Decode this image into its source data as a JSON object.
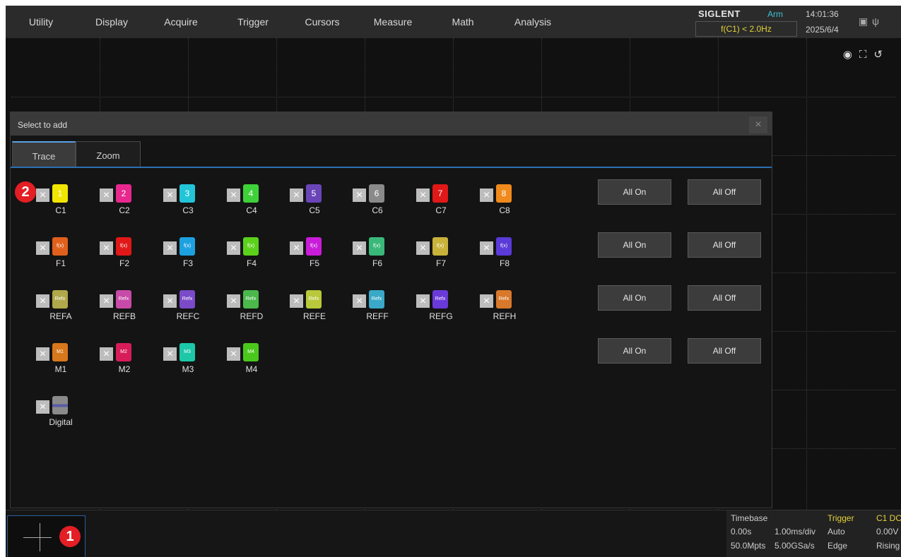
{
  "menu": [
    "Utility",
    "Display",
    "Acquire",
    "Trigger",
    "Cursors",
    "Measure",
    "Math",
    "Analysis"
  ],
  "status": {
    "brand": "SIGLENT",
    "state": "Arm",
    "trigger_condition": "f(C1) < 2.0Hz",
    "time": "14:01:36",
    "date": "2025/6/4"
  },
  "toolbar_icons": [
    "camera-icon",
    "fullscreen-icon",
    "rotate-icon"
  ],
  "dialog": {
    "title": "Select to add",
    "close": "×",
    "tabs": [
      "Trace",
      "Zoom"
    ],
    "active_tab": "Trace",
    "rows": [
      {
        "items": [
          {
            "label": "C1",
            "badge": "1",
            "color": "#f2e600"
          },
          {
            "label": "C2",
            "badge": "2",
            "color": "#e8278f"
          },
          {
            "label": "C3",
            "badge": "3",
            "color": "#22c4d8"
          },
          {
            "label": "C4",
            "badge": "4",
            "color": "#3fd13a"
          },
          {
            "label": "C5",
            "badge": "5",
            "color": "#6a45b8"
          },
          {
            "label": "C6",
            "badge": "6",
            "color": "#8a8a8a"
          },
          {
            "label": "C7",
            "badge": "7",
            "color": "#e01818"
          },
          {
            "label": "C8",
            "badge": "8",
            "color": "#f08a1c"
          }
        ]
      },
      {
        "items": [
          {
            "label": "F1",
            "badge": "f(x)",
            "color": "#e0601c"
          },
          {
            "label": "F2",
            "badge": "f(x)",
            "color": "#e01818"
          },
          {
            "label": "F3",
            "badge": "f(x)",
            "color": "#1ca0e0"
          },
          {
            "label": "F4",
            "badge": "f(x)",
            "color": "#5cd11c"
          },
          {
            "label": "F5",
            "badge": "f(x)",
            "color": "#c81cd8"
          },
          {
            "label": "F6",
            "badge": "f(x)",
            "color": "#3ab87a"
          },
          {
            "label": "F7",
            "badge": "f(x)",
            "color": "#c8b23a"
          },
          {
            "label": "F8",
            "badge": "f(x)",
            "color": "#5a3ad8"
          }
        ]
      },
      {
        "items": [
          {
            "label": "REFA",
            "badge": "Refx",
            "color": "#b0a84a"
          },
          {
            "label": "REFB",
            "badge": "Refx",
            "color": "#c84aa8"
          },
          {
            "label": "REFC",
            "badge": "Refx",
            "color": "#7a4ac8"
          },
          {
            "label": "REFD",
            "badge": "Refx",
            "color": "#4ab84a"
          },
          {
            "label": "REFE",
            "badge": "Refx",
            "color": "#b8c83a"
          },
          {
            "label": "REFF",
            "badge": "Refx",
            "color": "#3aa8c8"
          },
          {
            "label": "REFG",
            "badge": "Refx",
            "color": "#6a3ad8"
          },
          {
            "label": "REFH",
            "badge": "Refx",
            "color": "#d8782a"
          }
        ]
      },
      {
        "items": [
          {
            "label": "M1",
            "badge": "M1",
            "color": "#d8781c"
          },
          {
            "label": "M2",
            "badge": "M2",
            "color": "#d81c5a"
          },
          {
            "label": "M3",
            "badge": "M3",
            "color": "#1cc8a8"
          },
          {
            "label": "M4",
            "badge": "M4",
            "color": "#4ac81c"
          }
        ]
      },
      {
        "items": [
          {
            "label": "Digital",
            "badge": "",
            "color": "#8a8a8a"
          }
        ]
      }
    ],
    "row_buttons": {
      "on": "All On",
      "off": "All Off"
    },
    "markers": [
      "2",
      "1"
    ]
  },
  "timebase": {
    "title": "Timebase",
    "delay": "0.00s",
    "scale": "1.00ms/div",
    "memory": "50.0Mpts",
    "sample_rate": "5.00GSa/s"
  },
  "trigger": {
    "title": "Trigger",
    "mode": "Auto",
    "type": "Edge",
    "source": "C1 DC",
    "level": "0.00V",
    "slope": "Rising"
  }
}
